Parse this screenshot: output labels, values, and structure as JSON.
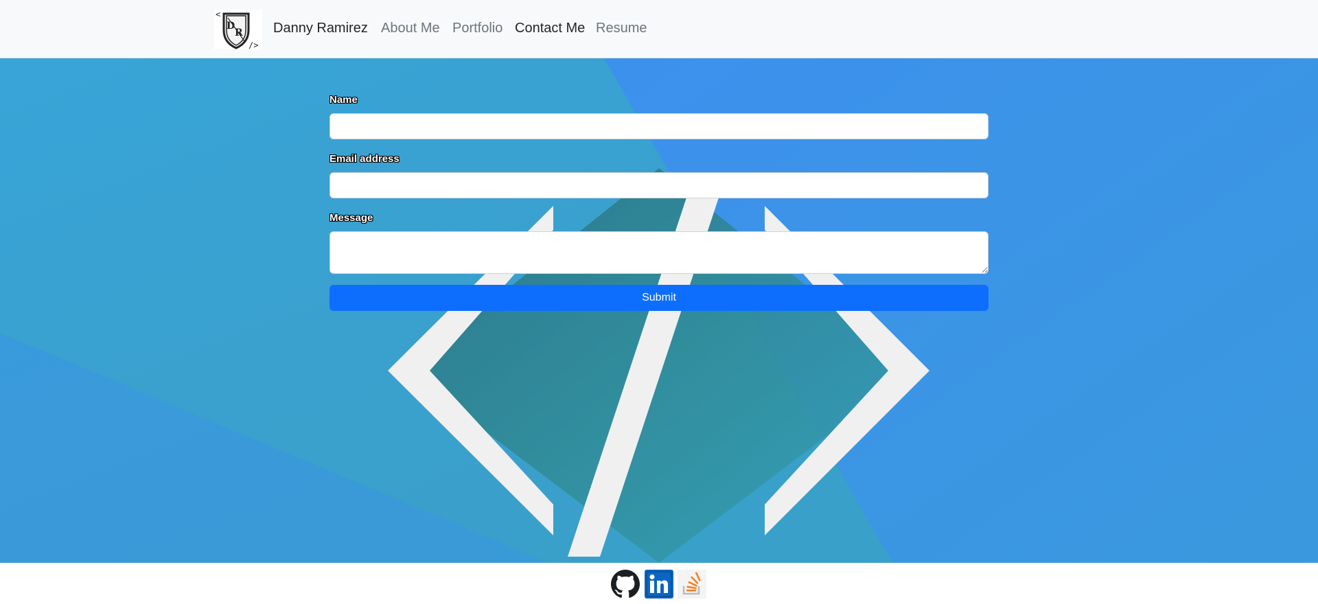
{
  "navbar": {
    "logo_icon": "dr-shield-logo-icon",
    "brand": "Danny Ramirez",
    "links": [
      {
        "label": "About Me",
        "active": false
      },
      {
        "label": "Portfolio",
        "active": false
      },
      {
        "label": "Contact Me",
        "active": true
      },
      {
        "label": "Resume",
        "active": false
      }
    ]
  },
  "form": {
    "name_label": "Name",
    "name_value": "",
    "email_label": "Email address",
    "email_value": "",
    "message_label": "Message",
    "message_value": "",
    "submit_label": "Submit"
  },
  "footer": {
    "icons": [
      "github-icon",
      "linkedin-icon",
      "stackoverflow-icon"
    ]
  },
  "colors": {
    "primary": "#0d6efd",
    "hero_blue": "#3a93e6",
    "hero_teal": "#2f8a8f",
    "navbar_bg": "#f8f9fa"
  }
}
